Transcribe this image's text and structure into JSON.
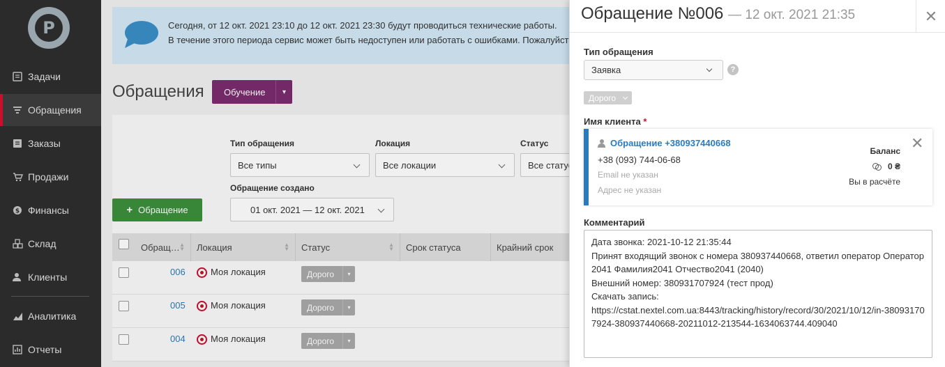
{
  "sidebar": {
    "logo_letter": "P",
    "items": [
      {
        "label": "Задачи",
        "icon": "tasks-icon"
      },
      {
        "label": "Обращения",
        "icon": "filter-icon"
      },
      {
        "label": "Заказы",
        "icon": "orders-icon"
      },
      {
        "label": "Продажи",
        "icon": "cart-icon"
      },
      {
        "label": "Финансы",
        "icon": "dollar-icon"
      },
      {
        "label": "Склад",
        "icon": "warehouse-icon"
      },
      {
        "label": "Клиенты",
        "icon": "users-icon"
      },
      {
        "label": "Аналитика",
        "icon": "chart-icon"
      },
      {
        "label": "Отчеты",
        "icon": "reports-icon"
      }
    ],
    "active_index": 1
  },
  "notice": {
    "line1": "Сегодня, от 12 окт. 2021 23:10 до 12 окт. 2021 23:30 будут проводиться технические работы.",
    "line2": "В течение этого периода сервис может быть недоступен или работать с ошибками. Пожалуйста,"
  },
  "page": {
    "title": "Обращения",
    "training_label": "Обучение",
    "add_button": "Обращение"
  },
  "filters": {
    "type_label": "Тип обращения",
    "type_value": "Все типы",
    "location_label": "Локация",
    "location_value": "Все локации",
    "status_label": "Статус",
    "status_value": "Все статус",
    "created_label": "Обращение создано",
    "created_value": "01 окт. 2021 — 12 окт. 2021"
  },
  "table": {
    "columns": [
      "Обращ…",
      "Локация",
      "Статус",
      "Срок статуса",
      "Крайний срок"
    ],
    "rows": [
      {
        "num": "006",
        "location": "Моя локация",
        "status": "Дорого"
      },
      {
        "num": "005",
        "location": "Моя локация",
        "status": "Дорого"
      },
      {
        "num": "004",
        "location": "Моя локация",
        "status": "Дорого"
      }
    ]
  },
  "panel": {
    "title": "Обращение №006",
    "date": "— 12 окт. 2021 21:35",
    "type_label": "Тип обращения",
    "type_value": "Заявка",
    "tag": "Дорого",
    "client_label": "Имя клиента",
    "required_mark": "*",
    "client": {
      "name": "Обращение +380937440668",
      "phone": "+38 (093) 744-06-68",
      "email": "Email не указан",
      "address": "Адрес не указан",
      "balance_label": "Баланс",
      "balance_value": "0 ₴",
      "balance_note": "Вы в расчёте"
    },
    "comment_label": "Комментарий",
    "comment": "Дата звонка: 2021-10-12 21:35:44\nПринят входящий звонок с номера 380937440668, ответил оператор Оператор2041 Фамилия2041 Отчество2041 (2040)\nВнешний номер: 380931707924 (тест прод)\nСкачать запись:\nhttps://cstat.nextel.com.ua:8443/tracking/history/record/30/2021/10/12/in-380931707924-380937440668-20211012-213544-1634063744.409040"
  },
  "colors": {
    "sidebar_bg": "#2b2b2b",
    "accent_red": "#c8102e",
    "link_blue": "#2a7bbd",
    "training_purple": "#7b2b6e",
    "add_green": "#3c8f3c",
    "notice_bg": "#d3e8f7"
  }
}
